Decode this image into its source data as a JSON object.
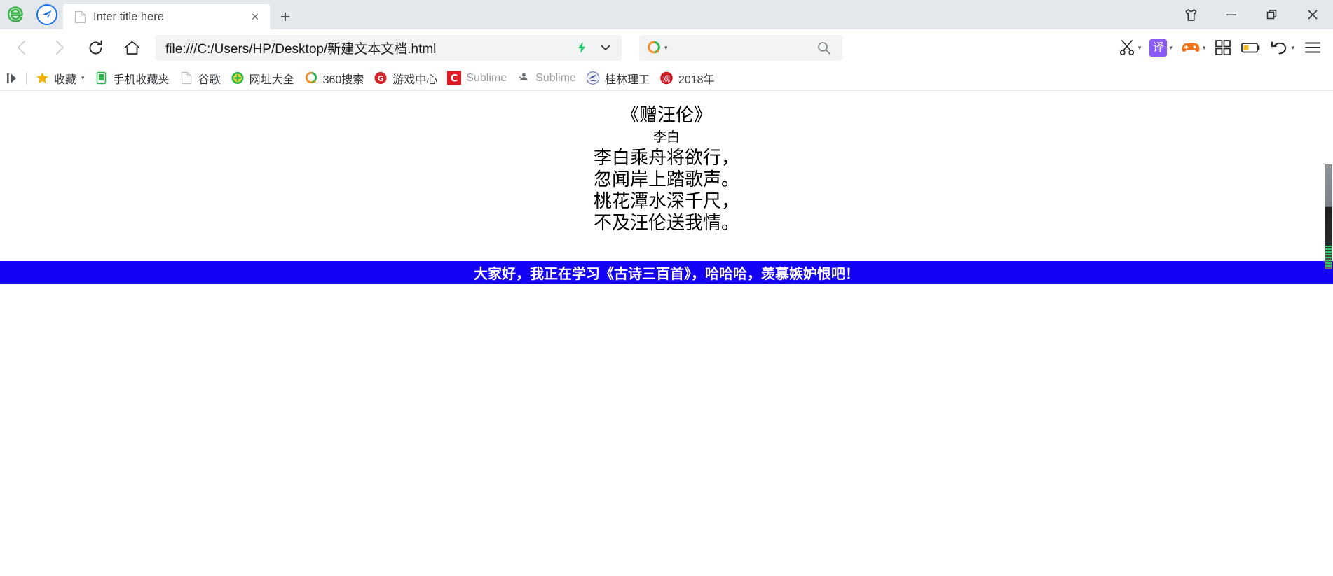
{
  "window": {
    "browser_icon": "ie-e-logo-icon",
    "plane_icon": "paper-plane-icon",
    "controls": {
      "skin": "tshirt-skin-icon",
      "minimize": "minimize-icon",
      "maximize": "restore-icon",
      "close": "close-icon"
    }
  },
  "tabs": [
    {
      "title": "Inter title here",
      "favicon": "document-icon",
      "close_label": "×",
      "active": true
    }
  ],
  "newtab_label": "+",
  "nav": {
    "back": "back-arrow-icon",
    "forward": "forward-arrow-icon",
    "reload": "reload-icon",
    "home": "home-icon"
  },
  "omnibox": {
    "url": "file:///C:/Users/HP/Desktop/新建文本文档.html",
    "lightning_icon": "lightning-bolt-icon",
    "dropdown_icon": "chevron-down-icon"
  },
  "search": {
    "engine": "360-search-icon",
    "value": "",
    "placeholder": "",
    "submit_icon": "magnifier-icon"
  },
  "toolbar": [
    {
      "name": "screenshot-scissors-button",
      "icon": "scissors-icon",
      "caret": true
    },
    {
      "name": "translate-button",
      "icon": "translate-icon",
      "label": "译",
      "caret": true
    },
    {
      "name": "game-center-button",
      "icon": "gamepad-icon",
      "caret": true
    },
    {
      "name": "apps-grid-button",
      "icon": "grid-apps-icon",
      "caret": false
    },
    {
      "name": "battery-saver-button",
      "icon": "battery-icon",
      "caret": false
    },
    {
      "name": "undo-button",
      "icon": "undo-arrow-icon",
      "caret": true
    },
    {
      "name": "main-menu-button",
      "icon": "hamburger-menu-icon",
      "caret": false
    }
  ],
  "bookmarks": {
    "sidebar_toggle_icon": "sidebar-toggle-icon",
    "items": [
      {
        "label": "收藏",
        "icon": "star-icon",
        "caret": true,
        "grey": false
      },
      {
        "label": "手机收藏夹",
        "icon": "phone-icon",
        "caret": false,
        "grey": false
      },
      {
        "label": "谷歌",
        "icon": "document-icon",
        "caret": false,
        "grey": false
      },
      {
        "label": "网址大全",
        "icon": "hao360-icon",
        "caret": false,
        "grey": false
      },
      {
        "label": "360搜索",
        "icon": "360-search-icon",
        "caret": false,
        "grey": false
      },
      {
        "label": "游戏中心",
        "icon": "game-center-icon",
        "caret": false,
        "grey": false
      },
      {
        "label": "Sublime",
        "icon": "sublime-c-icon",
        "caret": false,
        "grey": true
      },
      {
        "label": "Sublime",
        "icon": "sublime-grey-icon",
        "caret": false,
        "grey": true
      },
      {
        "label": "桂林理工",
        "icon": "glut-university-icon",
        "caret": false,
        "grey": false
      },
      {
        "label": "2018年",
        "icon": "red-seal-icon",
        "caret": false,
        "grey": false
      }
    ]
  },
  "page": {
    "poem": {
      "title": "《赠汪伦》",
      "author": "李白",
      "lines": [
        "李白乘舟将欲行，",
        "忽闻岸上踏歌声。",
        "桃花潭水深千尺，",
        "不及汪伦送我情。"
      ]
    },
    "marquee": {
      "text": "大家好，我正在学习《古诗三百首》，哈哈哈，羡慕嫉妒恨吧！",
      "background": "#1400f5",
      "color": "#ffffff"
    }
  },
  "colors": {
    "titlebar": "#e4e7eb",
    "omnibox": "#f1f3f4",
    "marquee_blue": "#1400f5",
    "accent_green": "#2ecc5f",
    "translate_purple": "#8a5cf5",
    "gamepad_orange": "#f97316"
  }
}
